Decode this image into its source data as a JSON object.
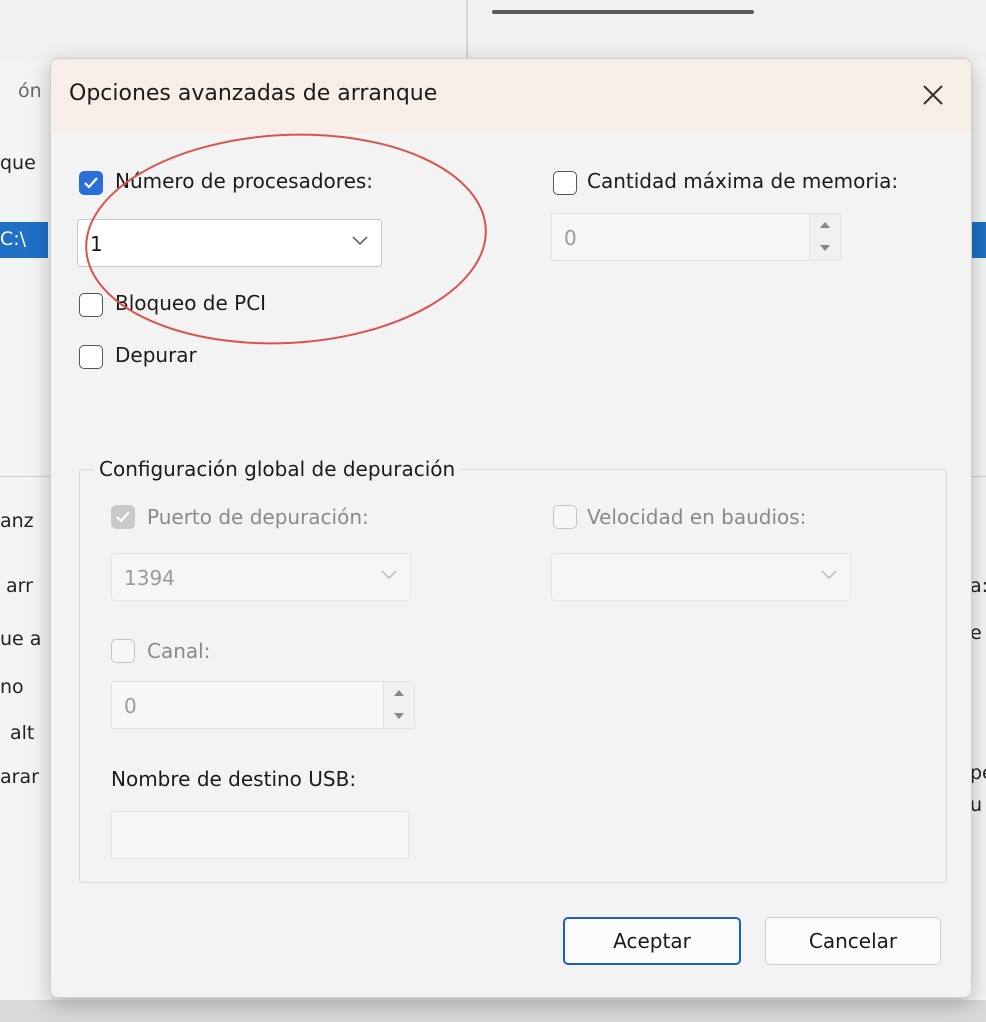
{
  "background": {
    "left_fragments": [
      "ón",
      "que",
      "C:\\",
      "anz",
      "arr",
      "ue a",
      "no",
      "alt",
      "arar"
    ],
    "right_fragments": [
      "a:",
      "e",
      "pe",
      "u"
    ]
  },
  "dialog": {
    "title": "Opciones avanzadas de arranque",
    "close_icon": "close-icon",
    "num_processors": {
      "label": "Número de procesadores:",
      "checked": true,
      "value": "1"
    },
    "max_memory": {
      "label": "Cantidad máxima de memoria:",
      "checked": false,
      "value": "0"
    },
    "pci_lock": {
      "label": "Bloqueo de PCI",
      "checked": false
    },
    "debug": {
      "label": "Depurar",
      "checked": false
    },
    "debug_group": {
      "title": "Configuración global de depuración",
      "debug_port": {
        "label": "Puerto de depuración:",
        "checked": true,
        "value": "1394"
      },
      "baud_rate": {
        "label": "Velocidad en baudios:",
        "checked": false,
        "value": ""
      },
      "channel": {
        "label": "Canal:",
        "checked": false,
        "value": "0"
      },
      "usb_target": {
        "label": "Nombre de destino USB:",
        "value": ""
      }
    },
    "ok_label": "Aceptar",
    "cancel_label": "Cancelar"
  },
  "colors": {
    "accent": "#2a6fd6",
    "annotation": "#d9534f"
  }
}
